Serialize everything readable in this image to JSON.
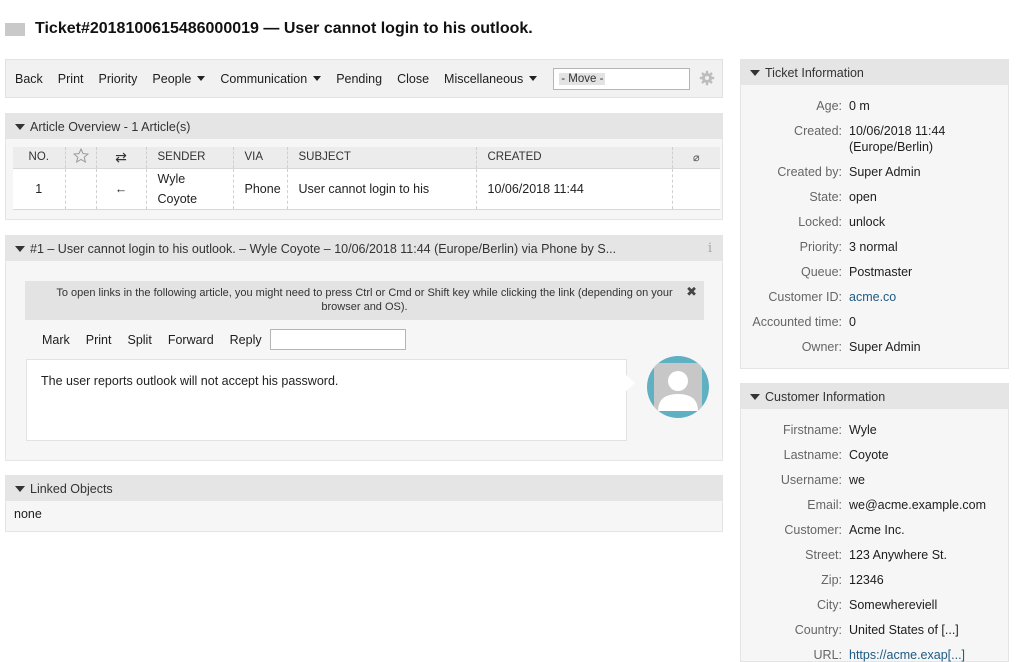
{
  "title": "Ticket#2018100615486000019 — User cannot login to his outlook.",
  "toolbar": {
    "back": "Back",
    "print": "Print",
    "priority": "Priority",
    "people": "People",
    "communication": "Communication",
    "pending": "Pending",
    "close": "Close",
    "misc": "Miscellaneous",
    "move": "- Move -"
  },
  "article_overview": {
    "title": "Article Overview - 1 Article(s)",
    "headers": {
      "no": "NO.",
      "sender": "SENDER",
      "via": "VIA",
      "subject": "SUBJECT",
      "created": "CREATED"
    },
    "row": {
      "no": "1",
      "direction": "←",
      "sender_first": "Wyle",
      "sender_last": "Coyote",
      "via": "Phone",
      "subject": "User cannot login to his",
      "created": "10/06/2018 11:44"
    }
  },
  "article": {
    "header": "#1 – User cannot login to his outlook. – Wyle Coyote – 10/06/2018 11:44 (Europe/Berlin) via Phone by S...",
    "notice": "To open links in the following article, you might need to press Ctrl or Cmd or Shift key while clicking the link (depending on your browser and OS).",
    "actions": {
      "mark": "Mark",
      "print": "Print",
      "split": "Split",
      "forward": "Forward",
      "reply": "Reply"
    },
    "body": "The user reports outlook will not accept his password."
  },
  "linked_objects": {
    "title": "Linked Objects",
    "value": "none"
  },
  "ticket_info": {
    "title": "Ticket Information",
    "rows": [
      {
        "label": "Age:",
        "value": "0 m"
      },
      {
        "label": "Created:",
        "value": "10/06/2018 11:44",
        "value2": "(Europe/Berlin)"
      },
      {
        "label": "Created by:",
        "value": "Super Admin"
      },
      {
        "label": "State:",
        "value": "open"
      },
      {
        "label": "Locked:",
        "value": "unlock"
      },
      {
        "label": "Priority:",
        "value": "3 normal"
      },
      {
        "label": "Queue:",
        "value": "Postmaster"
      },
      {
        "label": "Customer ID:",
        "value": "acme.co"
      },
      {
        "label": "Accounted time:",
        "value": "0"
      },
      {
        "label": "Owner:",
        "value": "Super Admin"
      }
    ]
  },
  "customer_info": {
    "title": "Customer Information",
    "rows": [
      {
        "label": "Firstname:",
        "value": "Wyle"
      },
      {
        "label": "Lastname:",
        "value": "Coyote"
      },
      {
        "label": "Username:",
        "value": "we"
      },
      {
        "label": "Email:",
        "value": "we@acme.example.com"
      },
      {
        "label": "Customer:",
        "value": "Acme Inc."
      },
      {
        "label": "Street:",
        "value": "123 Anywhere St."
      },
      {
        "label": "Zip:",
        "value": "12346"
      },
      {
        "label": "City:",
        "value": "Somewhereviell"
      },
      {
        "label": "Country:",
        "value": "United States of [...]"
      },
      {
        "label": "URL:",
        "value": "https://acme.exap[...]"
      }
    ]
  },
  "colors": {
    "link": "#1e5a84",
    "avatar": "#5fb0c2",
    "header_bg": "#e5e5e5"
  }
}
